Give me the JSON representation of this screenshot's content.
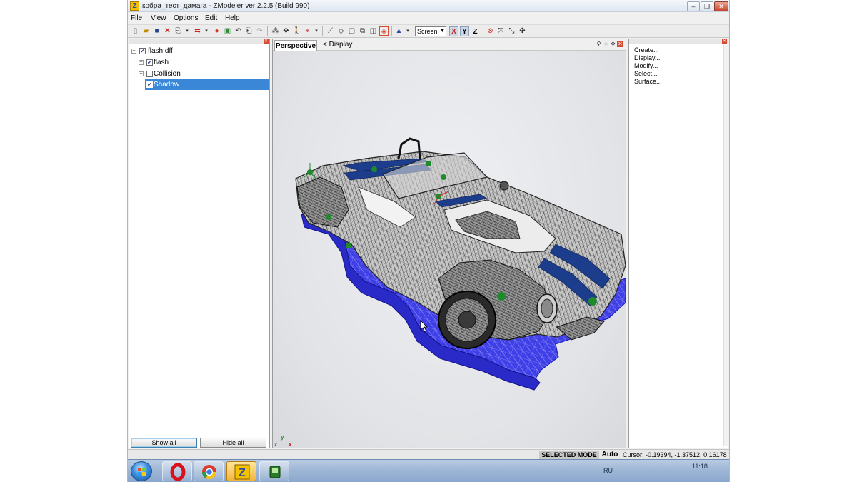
{
  "window": {
    "app_icon": "Z",
    "title": "кобра_тест_дамага - ZModeler ver 2.2.5 (Build 990)"
  },
  "menu": [
    {
      "underline": "F",
      "rest": "ile"
    },
    {
      "underline": "V",
      "rest": "iew"
    },
    {
      "underline": "O",
      "rest": "ptions"
    },
    {
      "underline": "E",
      "rest": "dit"
    },
    {
      "underline": "H",
      "rest": "elp"
    }
  ],
  "toolbar": {
    "view_mode": "Screen",
    "axes": [
      "X",
      "Y",
      "Z"
    ]
  },
  "scene_tree": {
    "items": [
      {
        "label": "flash.dff",
        "checked": true,
        "expander": "−",
        "selected": false
      },
      {
        "label": "flash",
        "checked": true,
        "expander": "+",
        "selected": false
      },
      {
        "label": "Collision",
        "checked": false,
        "expander": "+",
        "selected": false
      },
      {
        "label": "Shadow",
        "checked": true,
        "expander": "",
        "selected": true
      }
    ],
    "show_all_label": "Show all",
    "hide_all_label": "Hide all"
  },
  "viewport": {
    "tab_label": "Perspective",
    "display_label": "< Display",
    "axis_labels": [
      "z",
      "y",
      "x"
    ]
  },
  "command_panel": {
    "items": [
      "Create...",
      "Display...",
      "Modify...",
      "Select...",
      "Surface..."
    ]
  },
  "status": {
    "mode": "SELECTED MODE",
    "auto": "Auto",
    "cursor": "Cursor: -0.19394, -1.37512, 0.16178"
  },
  "taskbar": {
    "language": "RU",
    "time": "11:18"
  },
  "colors": {
    "selection": "#3a87d8",
    "mesh_shadow_blue": "#3a3ae6",
    "stripe_blue": "#1c3c8c",
    "dummy_green": "#1f8a2c"
  }
}
